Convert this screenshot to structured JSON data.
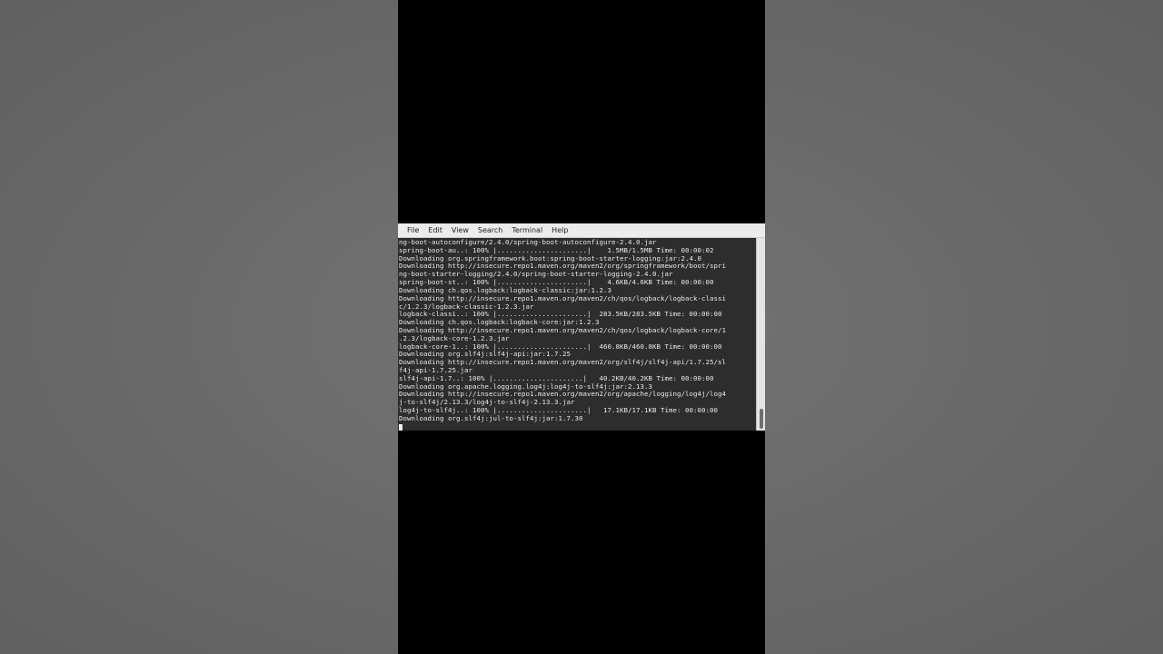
{
  "menubar": {
    "items": [
      "File",
      "Edit",
      "View",
      "Search",
      "Terminal",
      "Help"
    ]
  },
  "terminal": {
    "lines": [
      "ng-boot-autoconfigure/2.4.0/spring-boot-autoconfigure-2.4.0.jar",
      "spring-boot-au..: 100% |......................|    1.5MB/1.5MB Time: 00:00:02",
      "Downloading org.springframework.boot:spring-boot-starter-logging:jar:2.4.0",
      "Downloading http://insecure.repo1.maven.org/maven2/org/springframework/boot/spri",
      "ng-boot-starter-logging/2.4.0/spring-boot-starter-logging-2.4.0.jar",
      "spring-boot-st..: 100% |......................|    4.6KB/4.6KB Time: 00:00:00",
      "Downloading ch.qos.logback:logback-classic:jar:1.2.3",
      "Downloading http://insecure.repo1.maven.org/maven2/ch/qos/logback/logback-classi",
      "c/1.2.3/logback-classic-1.2.3.jar",
      "logback-classi..: 100% |......................|  283.5KB/283.5KB Time: 00:00:00",
      "Downloading ch.qos.logback:logback-core:jar:1.2.3",
      "Downloading http://insecure.repo1.maven.org/maven2/ch/qos/logback/logback-core/1",
      ".2.3/logback-core-1.2.3.jar",
      "logback-core-1..: 100% |......................|  460.8KB/460.8KB Time: 00:00:00",
      "Downloading org.slf4j:slf4j-api:jar:1.7.25",
      "Downloading http://insecure.repo1.maven.org/maven2/org/slf4j/slf4j-api/1.7.25/sl",
      "f4j-api-1.7.25.jar",
      "slf4j-api-1.7..: 100% |......................|   40.2KB/40.2KB Time: 00:00:00",
      "Downloading org.apache.logging.log4j:log4j-to-slf4j:jar:2.13.3",
      "Downloading http://insecure.repo1.maven.org/maven2/org/apache/logging/log4j/log4",
      "j-to-slf4j/2.13.3/log4j-to-slf4j-2.13.3.jar",
      "log4j-to-slf4j..: 100% |......................|   17.1KB/17.1KB Time: 00:00:00",
      "Downloading org.slf4j:jul-to-slf4j:jar:1.7.30"
    ]
  }
}
